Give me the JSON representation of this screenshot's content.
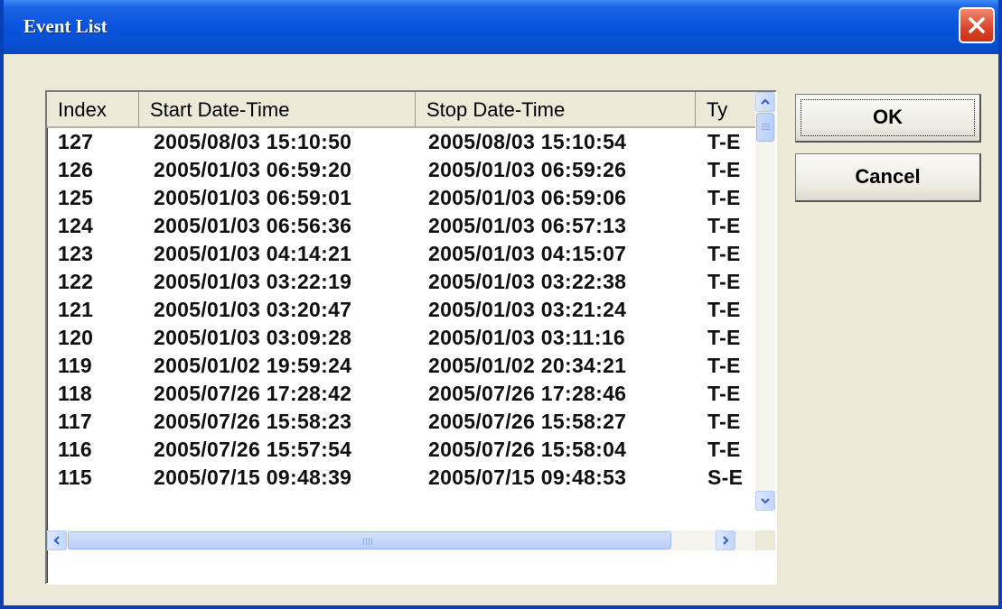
{
  "window": {
    "title": "Event List"
  },
  "columns": [
    "Index",
    "Start Date-Time",
    "Stop Date-Time",
    "Type"
  ],
  "column_headers_visible": [
    "Index",
    "Start Date-Time",
    "Stop Date-Time",
    "Ty"
  ],
  "rows": [
    {
      "index": "127",
      "start": "2005/08/03 15:10:50",
      "stop": "2005/08/03 15:10:54",
      "type": "T-E"
    },
    {
      "index": "126",
      "start": "2005/01/03 06:59:20",
      "stop": "2005/01/03 06:59:26",
      "type": "T-E"
    },
    {
      "index": "125",
      "start": "2005/01/03 06:59:01",
      "stop": "2005/01/03 06:59:06",
      "type": "T-E"
    },
    {
      "index": "124",
      "start": "2005/01/03 06:56:36",
      "stop": "2005/01/03 06:57:13",
      "type": "T-E"
    },
    {
      "index": "123",
      "start": "2005/01/03 04:14:21",
      "stop": "2005/01/03 04:15:07",
      "type": "T-E"
    },
    {
      "index": "122",
      "start": "2005/01/03 03:22:19",
      "stop": "2005/01/03 03:22:38",
      "type": "T-E"
    },
    {
      "index": "121",
      "start": "2005/01/03 03:20:47",
      "stop": "2005/01/03 03:21:24",
      "type": "T-E"
    },
    {
      "index": "120",
      "start": "2005/01/03 03:09:28",
      "stop": "2005/01/03 03:11:16",
      "type": "T-E"
    },
    {
      "index": "119",
      "start": "2005/01/02 19:59:24",
      "stop": "2005/01/02 20:34:21",
      "type": "T-E"
    },
    {
      "index": "118",
      "start": "2005/07/26 17:28:42",
      "stop": "2005/07/26 17:28:46",
      "type": "T-E"
    },
    {
      "index": "117",
      "start": "2005/07/26 15:58:23",
      "stop": "2005/07/26 15:58:27",
      "type": "T-E"
    },
    {
      "index": "116",
      "start": "2005/07/26 15:57:54",
      "stop": "2005/07/26 15:58:04",
      "type": "T-E"
    },
    {
      "index": "115",
      "start": "2005/07/15 09:48:39",
      "stop": "2005/07/15 09:48:53",
      "type": "S-E"
    }
  ],
  "buttons": {
    "ok": "OK",
    "cancel": "Cancel"
  },
  "icons": {
    "close": "close-icon",
    "up": "chevron-up-icon",
    "down": "chevron-down-icon",
    "left": "chevron-left-icon",
    "right": "chevron-right-icon"
  },
  "colors": {
    "titlebar": "#0A55DE",
    "dialog_bg": "#ECE9D8",
    "close_button": "#D8432A"
  }
}
